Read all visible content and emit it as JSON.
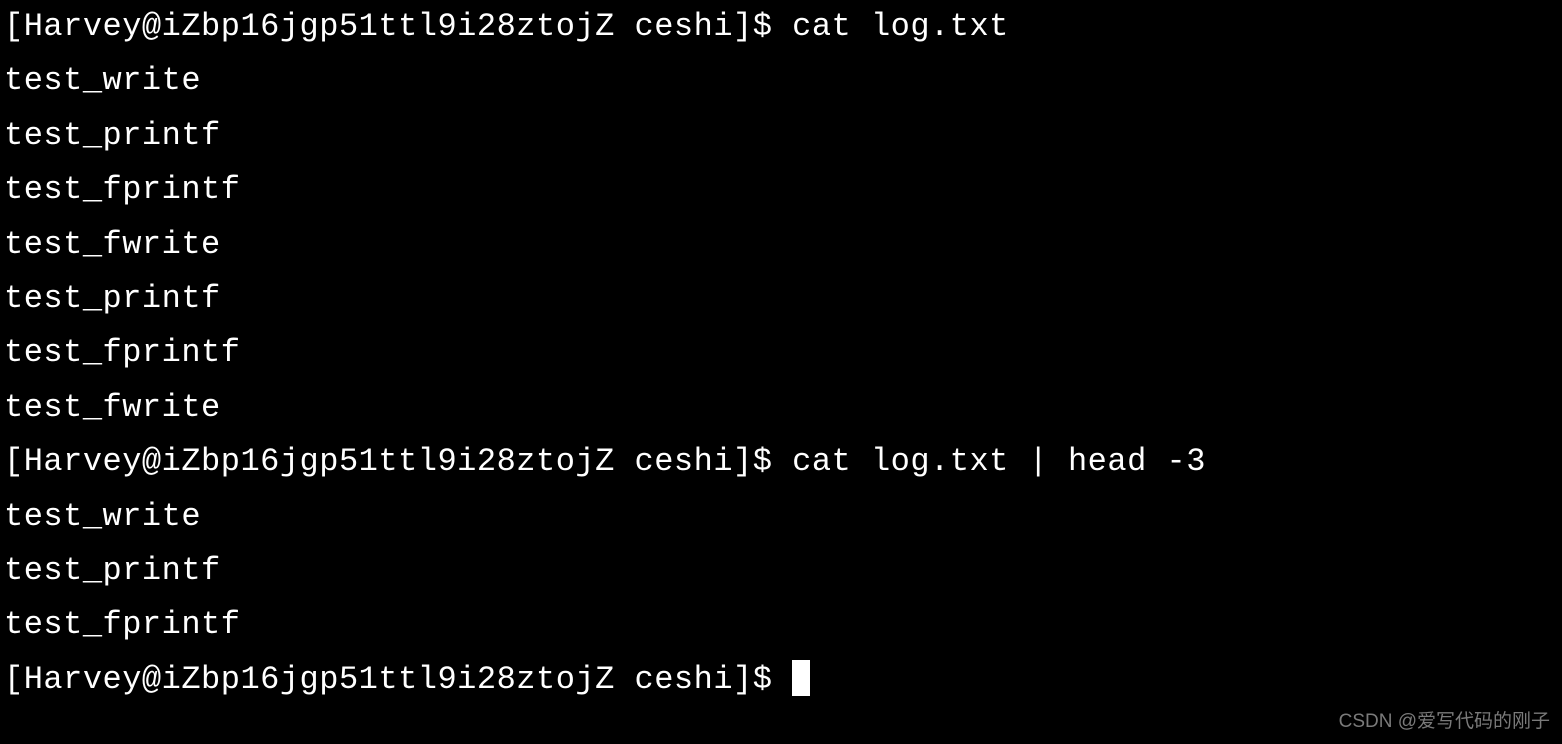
{
  "prompt": "[Harvey@iZbp16jgp51ttl9i28ztojZ ceshi]$ ",
  "commands": {
    "cmd1": "cat log.txt",
    "cmd2": "cat log.txt | head -3"
  },
  "output1": [
    "test_write",
    "test_printf",
    "test_fprintf",
    "test_fwrite",
    "test_printf",
    "test_fprintf",
    "test_fwrite"
  ],
  "output2": [
    "test_write",
    "test_printf",
    "test_fprintf"
  ],
  "watermark": "CSDN @爱写代码的刚子"
}
